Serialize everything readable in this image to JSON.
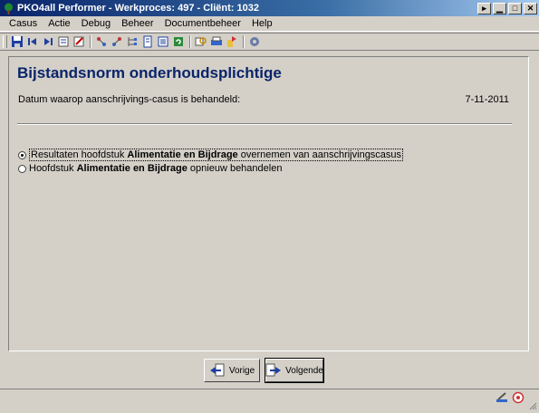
{
  "window": {
    "title": "PKO4all Performer - Werkproces: 497 - Cliënt: 1032",
    "minimize_glyph": "▁",
    "restore_glyph": "□",
    "close_glyph": "✕",
    "help_glyph": "▸"
  },
  "menu": [
    "Casus",
    "Actie",
    "Debug",
    "Beheer",
    "Documentbeheer",
    "Help"
  ],
  "toolbar": {
    "icons": [
      "save-icon",
      "first-record-icon",
      "last-record-icon",
      "note-icon",
      "edit-icon",
      "tree-expand-icon",
      "tree-collapse-icon",
      "tree-icon",
      "document-icon",
      "list-icon",
      "refresh-icon",
      "find-icon",
      "print-icon",
      "export-icon",
      "settings-icon"
    ]
  },
  "page": {
    "title": "Bijstandsnorm onderhoudsplichtige",
    "date_label": "Datum waarop aanschrijvings-casus is behandeld:",
    "date_value": "7-11-2011"
  },
  "options": [
    {
      "prefix": "Resultaten hoofdstuk ",
      "bold": "Alimentatie en Bijdrage",
      "suffix": " overnemen van aanschrijvingscasus",
      "checked": true
    },
    {
      "prefix": "Hoofdstuk ",
      "bold": "Alimentatie en Bijdrage",
      "suffix": " opnieuw behandelen",
      "checked": false
    }
  ],
  "buttons": {
    "prev_label": "Vorige",
    "next_label": "Volgende"
  },
  "colors": {
    "title_blue": "#0a246a",
    "face": "#d4d0c8"
  }
}
